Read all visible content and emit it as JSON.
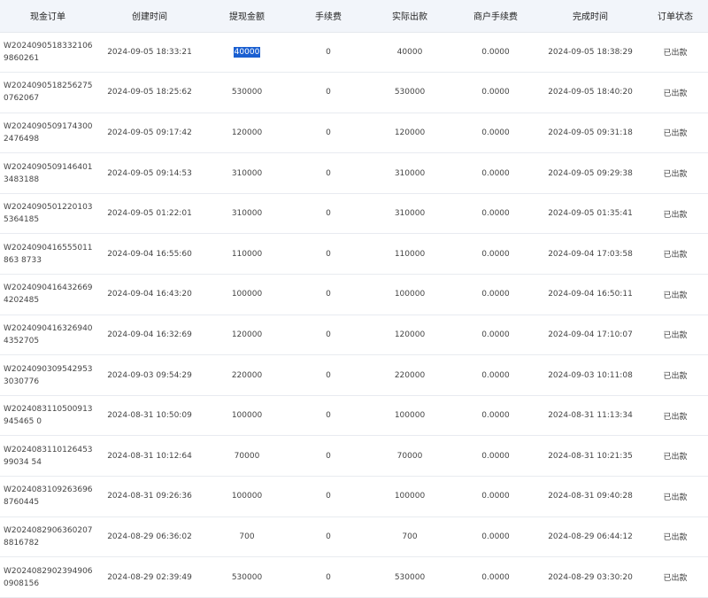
{
  "headers": [
    "现金订单",
    "创建时间",
    "提现金额",
    "手续费",
    "实际出款",
    "商户手续费",
    "完成时间",
    "订单状态"
  ],
  "rows": [
    {
      "order": "W20240905183321069860261",
      "created": "2024-09-05 18:33:21",
      "amount": "40000",
      "fee": "0",
      "actual": "40000",
      "merchant_fee": "0.0000",
      "completed": "2024-09-05 18:38:29",
      "status": "已出款",
      "highlight": true
    },
    {
      "order": "W20240905182562750762067",
      "created": "2024-09-05 18:25:62",
      "amount": "530000",
      "fee": "0",
      "actual": "530000",
      "merchant_fee": "0.0000",
      "completed": "2024-09-05 18:40:20",
      "status": "已出款"
    },
    {
      "order": "W20240905091743002476498",
      "created": "2024-09-05 09:17:42",
      "amount": "120000",
      "fee": "0",
      "actual": "120000",
      "merchant_fee": "0.0000",
      "completed": "2024-09-05 09:31:18",
      "status": "已出款"
    },
    {
      "order": "W20240905091464013483188",
      "created": "2024-09-05 09:14:53",
      "amount": "310000",
      "fee": "0",
      "actual": "310000",
      "merchant_fee": "0.0000",
      "completed": "2024-09-05 09:29:38",
      "status": "已出款"
    },
    {
      "order": "W20240905012201035364185",
      "created": "2024-09-05 01:22:01",
      "amount": "310000",
      "fee": "0",
      "actual": "310000",
      "merchant_fee": "0.0000",
      "completed": "2024-09-05 01:35:41",
      "status": "已出款"
    },
    {
      "order": "W2024090416555011863 8733",
      "created": "2024-09-04 16:55:60",
      "amount": "110000",
      "fee": "0",
      "actual": "110000",
      "merchant_fee": "0.0000",
      "completed": "2024-09-04 17:03:58",
      "status": "已出款"
    },
    {
      "order": "W20240904164326694202485",
      "created": "2024-09-04 16:43:20",
      "amount": "100000",
      "fee": "0",
      "actual": "100000",
      "merchant_fee": "0.0000",
      "completed": "2024-09-04 16:50:11",
      "status": "已出款"
    },
    {
      "order": "W20240904163269404352705",
      "created": "2024-09-04 16:32:69",
      "amount": "120000",
      "fee": "0",
      "actual": "120000",
      "merchant_fee": "0.0000",
      "completed": "2024-09-04 17:10:07",
      "status": "已出款"
    },
    {
      "order": "W20240903095429533030776",
      "created": "2024-09-03 09:54:29",
      "amount": "220000",
      "fee": "0",
      "actual": "220000",
      "merchant_fee": "0.0000",
      "completed": "2024-09-03 10:11:08",
      "status": "已出款"
    },
    {
      "order": "W2024083110500913945465 0",
      "created": "2024-08-31 10:50:09",
      "amount": "100000",
      "fee": "0",
      "actual": "100000",
      "merchant_fee": "0.0000",
      "completed": "2024-08-31 11:13:34",
      "status": "已出款"
    },
    {
      "order": "W202408311012645399034 54",
      "created": "2024-08-31 10:12:64",
      "amount": "70000",
      "fee": "0",
      "actual": "70000",
      "merchant_fee": "0.0000",
      "completed": "2024-08-31 10:21:35",
      "status": "已出款"
    },
    {
      "order": "W20240831092636968760445",
      "created": "2024-08-31 09:26:36",
      "amount": "100000",
      "fee": "0",
      "actual": "100000",
      "merchant_fee": "0.0000",
      "completed": "2024-08-31 09:40:28",
      "status": "已出款"
    },
    {
      "order": "W20240829063602078816782",
      "created": "2024-08-29 06:36:02",
      "amount": "700",
      "fee": "0",
      "actual": "700",
      "merchant_fee": "0.0000",
      "completed": "2024-08-29 06:44:12",
      "status": "已出款"
    },
    {
      "order": "W20240829023949060908156",
      "created": "2024-08-29 02:39:49",
      "amount": "530000",
      "fee": "0",
      "actual": "530000",
      "merchant_fee": "0.0000",
      "completed": "2024-08-29 03:30:20",
      "status": "已出款"
    }
  ]
}
